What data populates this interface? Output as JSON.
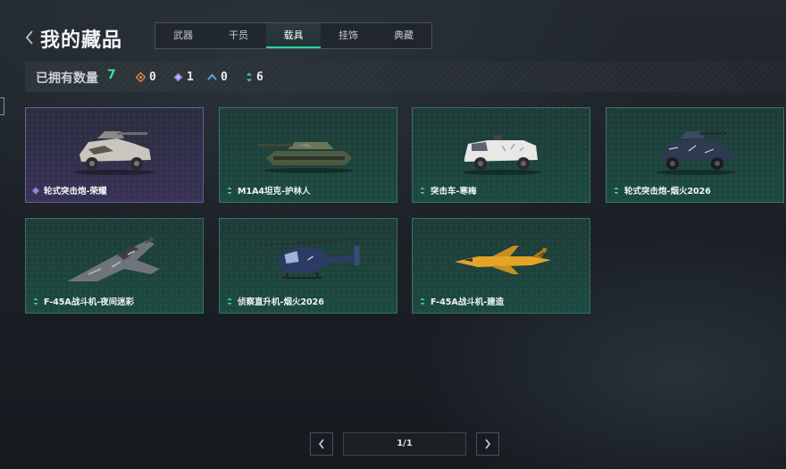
{
  "header": {
    "title": "我的藏品",
    "back_icon": "chevron-left-icon"
  },
  "tabs": [
    {
      "label": "武器",
      "active": false
    },
    {
      "label": "干员",
      "active": false
    },
    {
      "label": "载具",
      "active": true
    },
    {
      "label": "挂饰",
      "active": false
    },
    {
      "label": "典藏",
      "active": false
    }
  ],
  "stats": {
    "owned_label": "已拥有数量",
    "owned_count": "7",
    "rarities": [
      {
        "icon": "orange-diamond-icon",
        "color": "#e0804a",
        "count": "0"
      },
      {
        "icon": "purple-diamond-icon",
        "color": "#9b7fe6",
        "count": "1"
      },
      {
        "icon": "blue-chevron-icon",
        "color": "#5aa6e8",
        "count": "0"
      },
      {
        "icon": "green-arrow-icon",
        "color": "#3cd6a0",
        "count": "6"
      }
    ]
  },
  "items": [
    {
      "name": "轮式突击炮-荣耀",
      "rarity": "purple",
      "icon": "purple-diamond-icon",
      "art": "armored-car-icon"
    },
    {
      "name": "M1A4坦克-护林人",
      "rarity": "green",
      "icon": "green-arrow-icon",
      "art": "tank-icon"
    },
    {
      "name": "突击车-寒梅",
      "rarity": "green",
      "icon": "green-arrow-icon",
      "art": "assault-vehicle-icon"
    },
    {
      "name": "轮式突击炮-烟火2026",
      "rarity": "green",
      "icon": "green-arrow-icon",
      "art": "armored-car-icon"
    },
    {
      "name": "F-45A战斗机-夜间迷彩",
      "rarity": "green",
      "icon": "green-arrow-icon",
      "art": "fighter-jet-icon"
    },
    {
      "name": "侦察直升机-烟火2026",
      "rarity": "green",
      "icon": "green-arrow-icon",
      "art": "helicopter-icon"
    },
    {
      "name": "F-45A战斗机-建造",
      "rarity": "green",
      "icon": "green-arrow-icon",
      "art": "fighter-jet-icon"
    }
  ],
  "pagination": {
    "page": "1/1",
    "prev_icon": "chevron-left-icon",
    "next_icon": "chevron-right-icon"
  },
  "colors": {
    "accent": "#2bd3a8",
    "card_green": "#1c4a40",
    "card_purple": "#383257"
  }
}
